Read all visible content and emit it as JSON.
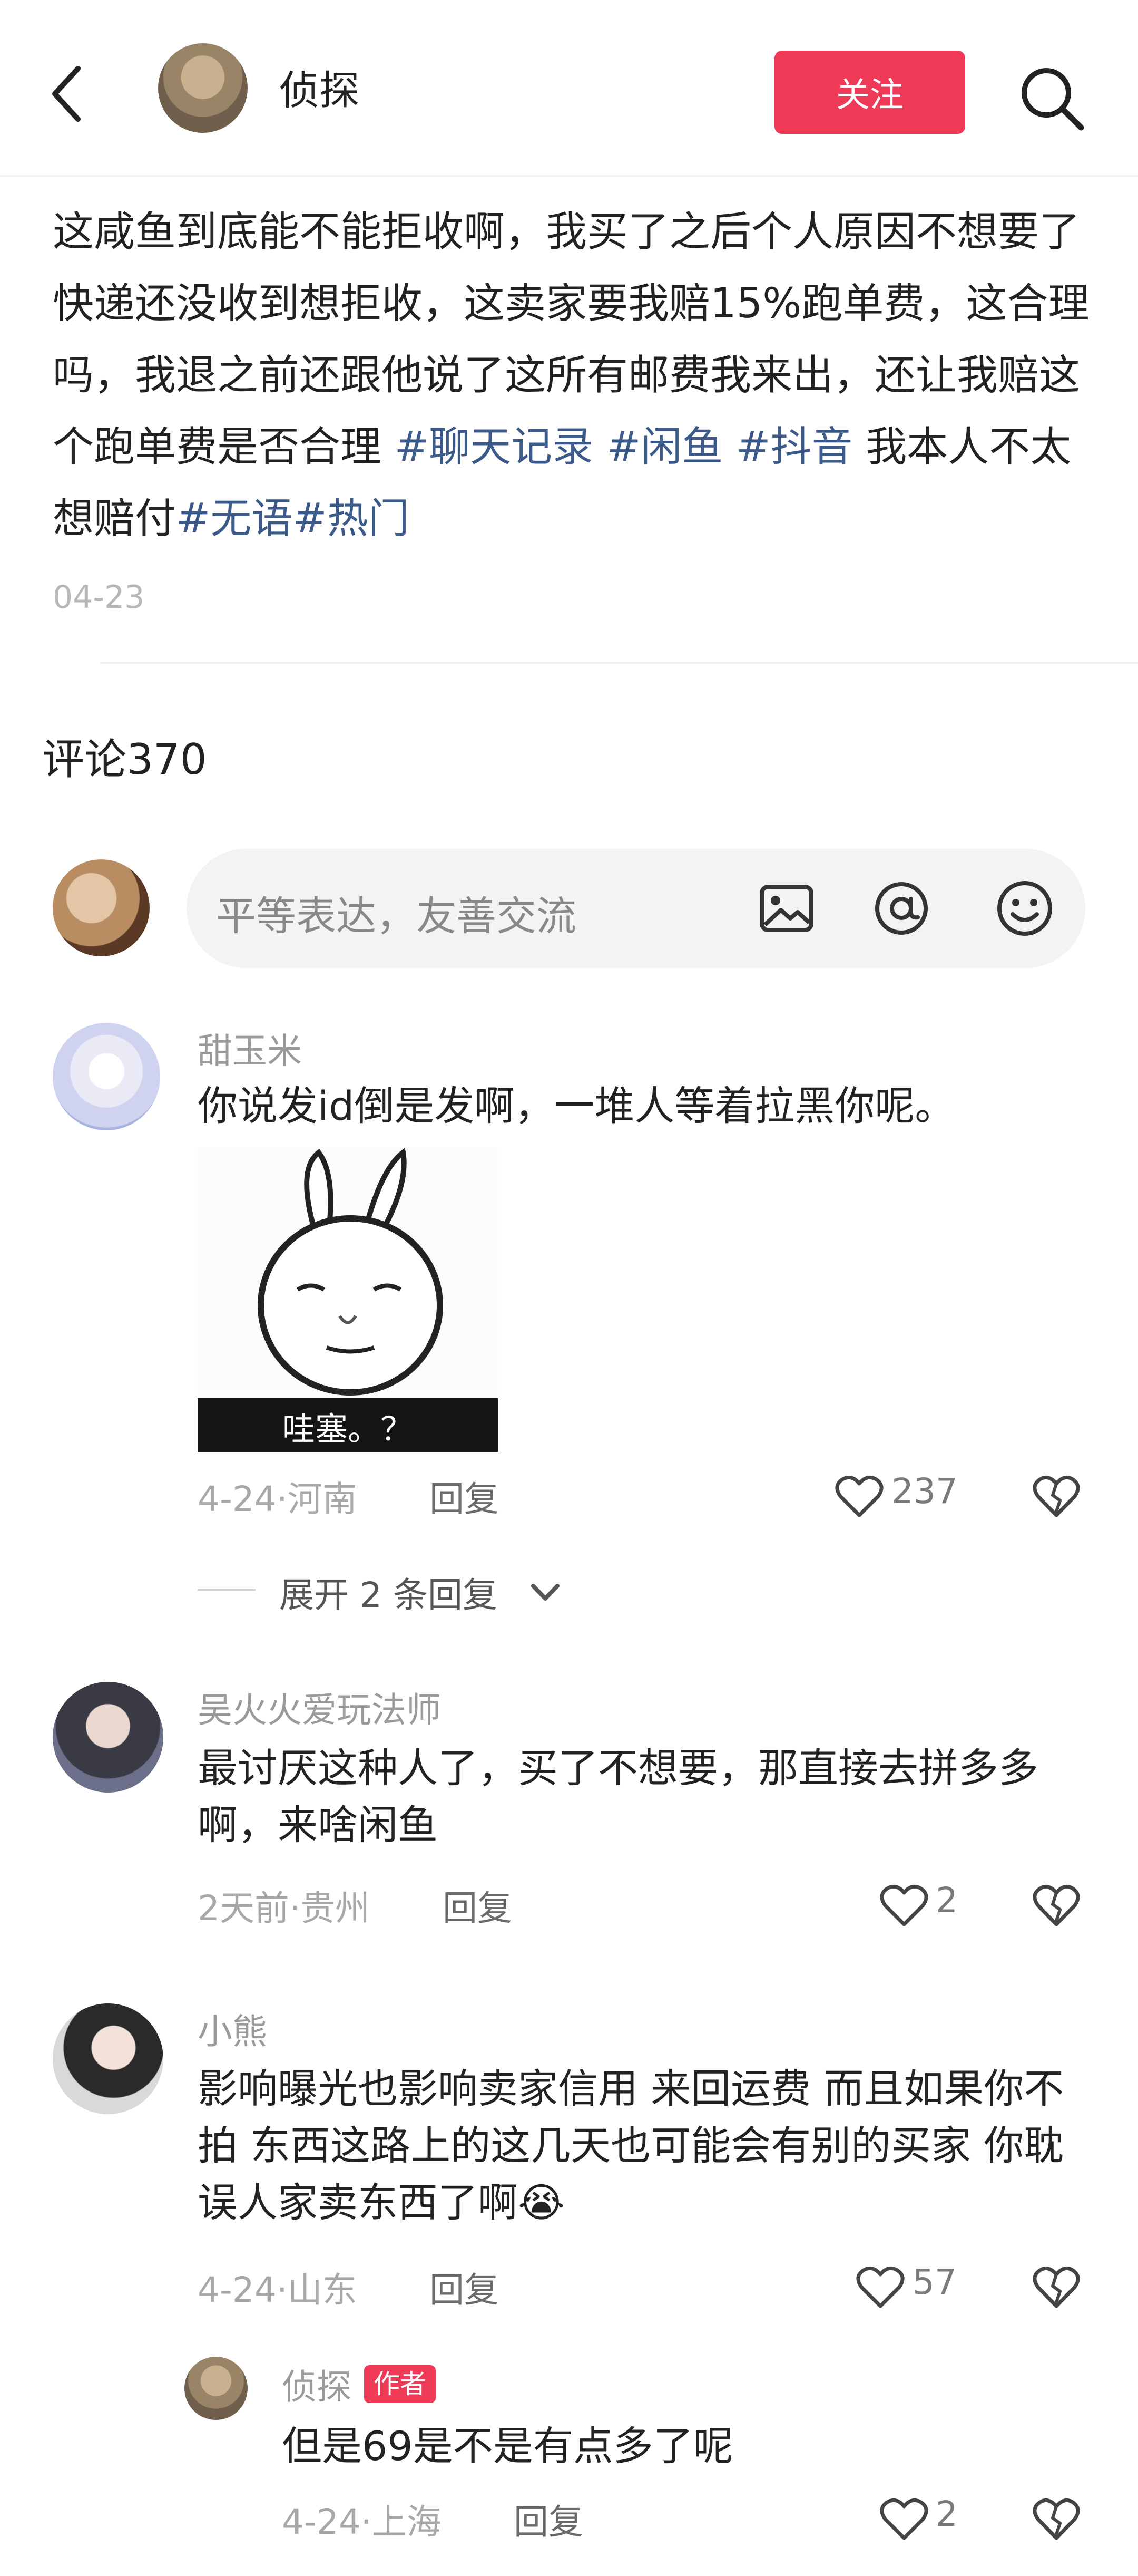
{
  "header": {
    "author_name": "侦探",
    "follow_label": "关注"
  },
  "post": {
    "text_plain_1": "这咸鱼到底能不能拒收啊，我买了之后个人原因不想要了快递还没收到想拒收，这卖家要我赔15%跑单费，这合理吗，我退之前还跟他说了这所有邮费我来出，还让我赔这个跑单费是否合理 ",
    "tag_1": "#聊天记录",
    "sep_1": " ",
    "tag_2": "#闲鱼",
    "sep_2": " ",
    "tag_3": "#抖音",
    "text_plain_2": " 我本人不太想赔付",
    "tag_4": "#无语",
    "tag_5": "#热门",
    "date": "04-23"
  },
  "comments_title": "评论370",
  "comment_input": {
    "placeholder": "平等表达，友善交流"
  },
  "comments": [
    {
      "name": "甜玉米",
      "text": "你说发id倒是发啊，一堆人等着拉黑你呢。",
      "sticker_caption": "哇塞。？",
      "meta": "4-24·河南",
      "reply_label": "回复",
      "likes": "237"
    },
    {
      "name": "吴火火爱玩法师",
      "text": "最讨厌这种人了，买了不想要，那直接去拼多多啊，来啥闲鱼",
      "meta": "2天前·贵州",
      "reply_label": "回复",
      "likes": "2"
    },
    {
      "name": "小熊",
      "text": "影响曝光也影响卖家信用 来回运费 而且如果你不拍 东西这路上的这几天也可能会有别的买家 你耽误人家卖东西了啊😭",
      "meta": "4-24·山东",
      "reply_label": "回复",
      "likes": "57"
    }
  ],
  "expand_replies": "展开 2 条回复",
  "sub_reply": {
    "name": "侦探",
    "badge": "作者",
    "text": "但是69是不是有点多了呢",
    "meta": "4-24·上海",
    "reply_label": "回复",
    "likes": "2"
  },
  "colors": {
    "accent_red": "#ee3a57",
    "tag_blue": "#3b5a8a"
  }
}
